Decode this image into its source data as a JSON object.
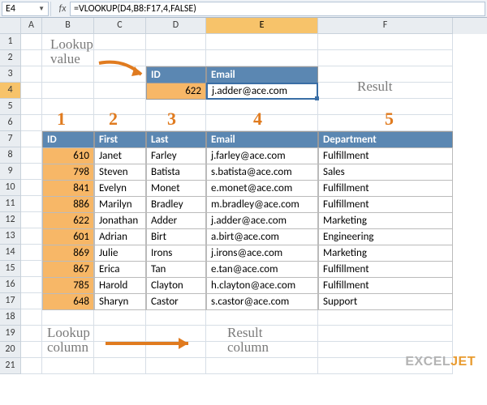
{
  "namebox": "E4",
  "formula": "=VLOOKUP(D4,B8:F17,4,FALSE)",
  "col_letters": [
    "A",
    "B",
    "C",
    "D",
    "E",
    "F"
  ],
  "selected_col": "E",
  "selected_row": 4,
  "annot": {
    "lookup_value_l1": "Lookup",
    "lookup_value_l2": "value",
    "result": "Result",
    "lookup_col_l1": "Lookup",
    "lookup_col_l2": "column",
    "result_col_l1": "Result",
    "result_col_l2": "column"
  },
  "col_numbers": [
    "1",
    "2",
    "3",
    "4",
    "5"
  ],
  "lookup": {
    "id_hdr": "ID",
    "email_hdr": "Email",
    "id_val": "622",
    "email_val": "j.adder@ace.com"
  },
  "headers": {
    "id": "ID",
    "first": "First",
    "last": "Last",
    "email": "Email",
    "dept": "Department"
  },
  "rows": [
    {
      "id": "610",
      "first": "Janet",
      "last": "Farley",
      "email": "j.farley@ace.com",
      "dept": "Fulfillment"
    },
    {
      "id": "798",
      "first": "Steven",
      "last": "Batista",
      "email": "s.batista@ace.com",
      "dept": "Sales"
    },
    {
      "id": "841",
      "first": "Evelyn",
      "last": "Monet",
      "email": "e.monet@ace.com",
      "dept": "Fulfillment"
    },
    {
      "id": "886",
      "first": "Marilyn",
      "last": "Bradley",
      "email": "m.bradley@ace.com",
      "dept": "Fulfillment"
    },
    {
      "id": "622",
      "first": "Jonathan",
      "last": "Adder",
      "email": "j.adder@ace.com",
      "dept": "Marketing"
    },
    {
      "id": "601",
      "first": "Adrian",
      "last": "Birt",
      "email": "a.birt@ace.com",
      "dept": "Engineering"
    },
    {
      "id": "869",
      "first": "Julie",
      "last": "Irons",
      "email": "j.irons@ace.com",
      "dept": "Marketing"
    },
    {
      "id": "867",
      "first": "Erica",
      "last": "Tan",
      "email": "e.tan@ace.com",
      "dept": "Fulfillment"
    },
    {
      "id": "785",
      "first": "Harold",
      "last": "Clayton",
      "email": "h.clayton@ace.com",
      "dept": "Fulfillment"
    },
    {
      "id": "648",
      "first": "Sharyn",
      "last": "Castor",
      "email": "s.castor@ace.com",
      "dept": "Support"
    }
  ],
  "logo_part1": "EXCEL",
  "logo_part2": "JET",
  "chart_data": {
    "type": "table",
    "title": "VLOOKUP example",
    "lookup_value": 622,
    "result": "j.adder@ace.com",
    "columns": [
      "ID",
      "First",
      "Last",
      "Email",
      "Department"
    ],
    "data": [
      [
        610,
        "Janet",
        "Farley",
        "j.farley@ace.com",
        "Fulfillment"
      ],
      [
        798,
        "Steven",
        "Batista",
        "s.batista@ace.com",
        "Sales"
      ],
      [
        841,
        "Evelyn",
        "Monet",
        "e.monet@ace.com",
        "Fulfillment"
      ],
      [
        886,
        "Marilyn",
        "Bradley",
        "m.bradley@ace.com",
        "Fulfillment"
      ],
      [
        622,
        "Jonathan",
        "Adder",
        "j.adder@ace.com",
        "Marketing"
      ],
      [
        601,
        "Adrian",
        "Birt",
        "a.birt@ace.com",
        "Engineering"
      ],
      [
        869,
        "Julie",
        "Irons",
        "j.irons@ace.com",
        "Marketing"
      ],
      [
        867,
        "Erica",
        "Tan",
        "e.tan@ace.com",
        "Fulfillment"
      ],
      [
        785,
        "Harold",
        "Clayton",
        "h.clayton@ace.com",
        "Fulfillment"
      ],
      [
        648,
        "Sharyn",
        "Castor",
        "s.castor@ace.com",
        "Support"
      ]
    ]
  }
}
